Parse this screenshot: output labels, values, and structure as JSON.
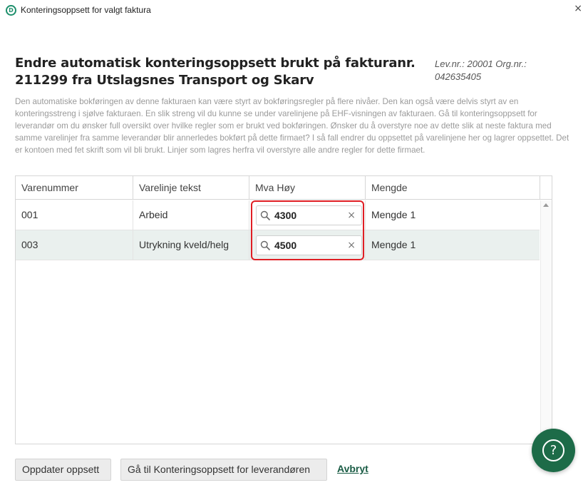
{
  "window": {
    "title": "Konteringsoppsett for valgt faktura",
    "logo_letter": "D",
    "close_glyph": "×"
  },
  "heading": {
    "title": "Endre automatisk konteringsoppsett brukt på fakturanr. 211299 fra Utslagsnes Transport og Skarv",
    "ids_line1": "Lev.nr.: 20001 Org.nr.:",
    "ids_line2": "042635405"
  },
  "description": "Den automatiske bokføringen av denne fakturaen kan være styrt av bokføringsregler på flere nivåer. Den kan også være delvis styrt av en konteringsstreng i sjølve fakturaen. En slik streng vil du kunne se under varelinjene på EHF-visningen av fakturaen. Gå til konteringsoppsett for leverandør om du ønsker full oversikt over hvilke regler som er brukt ved bokføringen. Ønsker du å overstyre noe av dette slik at neste faktura med samme varelinjer fra samme leverandør blir annerledes bokført på dette firmaet? I så fall endrer du oppsettet på varelinjene her og lagrer oppsettet. Det er kontoen med fet skrift som vil bli brukt. Linjer som lagres herfra vil overstyre alle andre regler for dette firmaet.",
  "table": {
    "columns": [
      "Varenummer",
      "Varelinje tekst",
      "Mva Høy",
      "Mengde"
    ],
    "rows": [
      {
        "varenummer": "001",
        "tekst": "Arbeid",
        "konto": "4300",
        "mengde": "Mengde 1"
      },
      {
        "varenummer": "003",
        "tekst": "Utrykning kveld/helg",
        "konto": "4500",
        "mengde": "Mengde 1"
      }
    ]
  },
  "icons": {
    "search": "search-icon",
    "clear": "×",
    "help": "?"
  },
  "footer": {
    "update_label": "Oppdater oppsett",
    "goto_label": "Gå til Konteringsoppsett for leverandøren",
    "cancel_label": "Avbryt"
  },
  "colors": {
    "brand_green": "#1d6b48",
    "highlight_red": "#e01e24",
    "alt_row": "#eaf0ee"
  }
}
